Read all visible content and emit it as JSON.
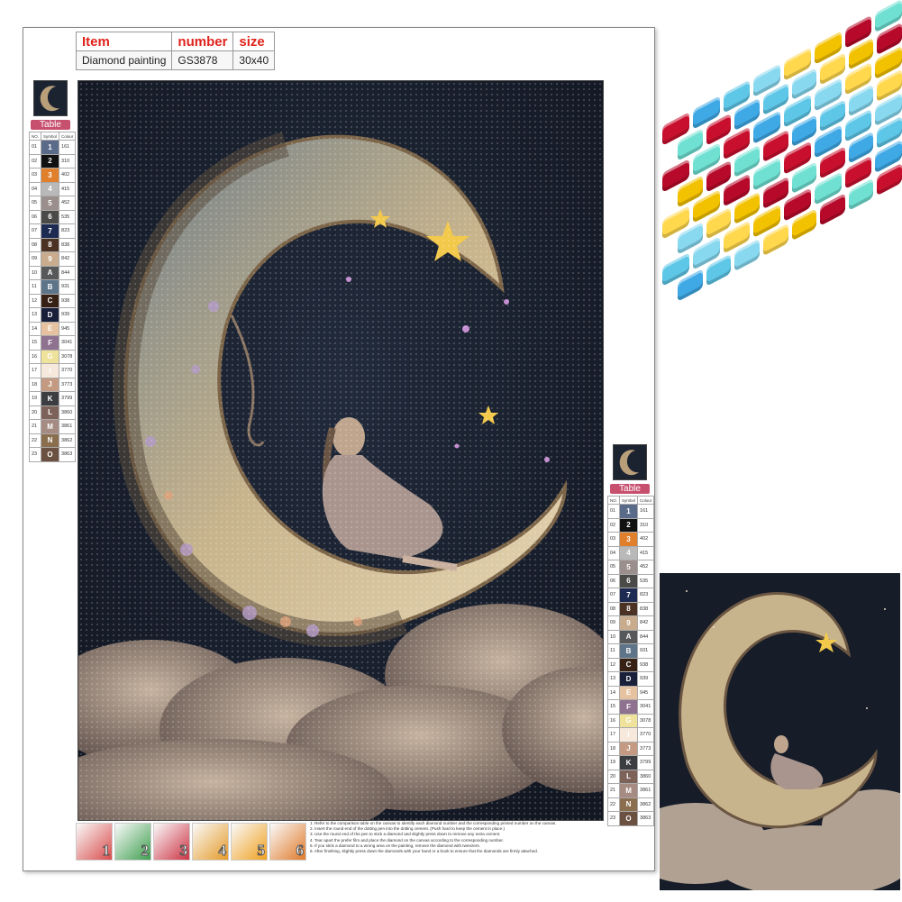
{
  "product_table": {
    "headers": [
      "Item",
      "number",
      "size"
    ],
    "row": [
      "Diamond painting",
      "GS3878",
      "30x40"
    ]
  },
  "color_table": {
    "title": "Table",
    "header": [
      "NO.",
      "Symbol",
      "Colour"
    ],
    "rows": [
      {
        "no": "01",
        "sym": "1",
        "code": "161",
        "color": "#5a6b8a"
      },
      {
        "no": "02",
        "sym": "2",
        "code": "310",
        "color": "#111111"
      },
      {
        "no": "03",
        "sym": "3",
        "code": "402",
        "color": "#e0802d"
      },
      {
        "no": "04",
        "sym": "4",
        "code": "415",
        "color": "#b9b9b9"
      },
      {
        "no": "05",
        "sym": "5",
        "code": "452",
        "color": "#9a8f8c"
      },
      {
        "no": "06",
        "sym": "6",
        "code": "535",
        "color": "#4a4a48"
      },
      {
        "no": "07",
        "sym": "7",
        "code": "823",
        "color": "#1d2a52"
      },
      {
        "no": "08",
        "sym": "8",
        "code": "838",
        "color": "#4b3222"
      },
      {
        "no": "09",
        "sym": "9",
        "code": "842",
        "color": "#c9ac8e"
      },
      {
        "no": "10",
        "sym": "A",
        "code": "844",
        "color": "#56585a"
      },
      {
        "no": "11",
        "sym": "B",
        "code": "931",
        "color": "#5e7488"
      },
      {
        "no": "12",
        "sym": "C",
        "code": "938",
        "color": "#362114"
      },
      {
        "no": "13",
        "sym": "D",
        "code": "939",
        "color": "#1a1f3a"
      },
      {
        "no": "14",
        "sym": "E",
        "code": "945",
        "color": "#e6c2a0"
      },
      {
        "no": "15",
        "sym": "F",
        "code": "3041",
        "color": "#8f7290"
      },
      {
        "no": "16",
        "sym": "G",
        "code": "3078",
        "color": "#efe29a"
      },
      {
        "no": "17",
        "sym": "I",
        "code": "3770",
        "color": "#f6e9dc"
      },
      {
        "no": "18",
        "sym": "J",
        "code": "3773",
        "color": "#c49a82"
      },
      {
        "no": "19",
        "sym": "K",
        "code": "3799",
        "color": "#3b3d40"
      },
      {
        "no": "20",
        "sym": "L",
        "code": "3860",
        "color": "#7d6259"
      },
      {
        "no": "21",
        "sym": "M",
        "code": "3861",
        "color": "#a58b82"
      },
      {
        "no": "22",
        "sym": "N",
        "code": "3862",
        "color": "#8a6e4d"
      },
      {
        "no": "23",
        "sym": "O",
        "code": "3863",
        "color": "#6b5141"
      }
    ]
  },
  "tools": [
    "1",
    "2",
    "3",
    "4",
    "5",
    "6"
  ],
  "instructions": [
    "1. Refer to the comparison table on the canvas to identify each diamond number and the corresponding printed number on the canvas.",
    "2. Insert the round end of the dotting pen into the dotting cement. (Push hard to keep the cement in place.)",
    "3. Use the round end of the pen to stick a diamond and slightly press down to remove any extra cement.",
    "4. Tear apart the prefer film and place the diamond on the canvas according to the corresponding number.",
    "5. If you stick a diamond to a wrong area on the painting, remove the diamond with tweezers.",
    "6. After finishing, slightly press down the diamonds with your hand or a book to ensure that the diamonds are firmly attached."
  ],
  "gem_colors": [
    "#c8102e",
    "#f2c100",
    "#5ec7e8",
    "#6fe0d2",
    "#ffd84d",
    "#3fa9e6",
    "#b70a2a",
    "#88d8ef"
  ],
  "icons": [
    "gem-strip",
    "moon-artwork",
    "star-icon"
  ]
}
